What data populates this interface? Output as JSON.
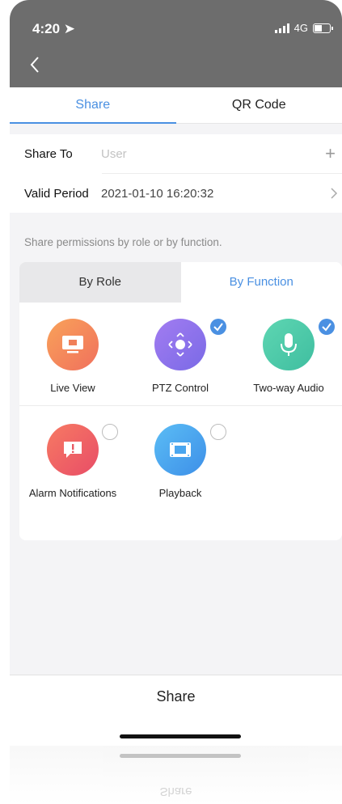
{
  "status": {
    "time": "4:20",
    "network": "4G"
  },
  "tabs": [
    {
      "label": "Share"
    },
    {
      "label": "QR Code"
    }
  ],
  "form": {
    "share_to": {
      "label": "Share To",
      "placeholder": "User"
    },
    "valid_period": {
      "label": "Valid Period",
      "value": "2021-01-10 16:20:32"
    }
  },
  "hint": "Share permissions by role or by function.",
  "segment": {
    "by_role": "By Role",
    "by_function": "By Function",
    "selected": "By Function"
  },
  "functions": [
    {
      "label": "Live View",
      "icon": "monitor-icon",
      "color": "#f5875a",
      "checked": false
    },
    {
      "label": "PTZ Control",
      "icon": "ptz-joystick-icon",
      "color": "#8f73e8",
      "checked": true
    },
    {
      "label": "Two-way Audio",
      "icon": "microphone-icon",
      "color": "#4ecaa8",
      "checked": true
    },
    {
      "label": "Alarm Notifications",
      "icon": "alarm-message-icon",
      "color": "#ef5f63",
      "checked": false
    },
    {
      "label": "Playback",
      "icon": "film-icon",
      "color": "#4aa6ef",
      "checked": false
    }
  ],
  "bottom": {
    "share_label": "Share"
  },
  "colors": {
    "accent": "#4a90e2",
    "header": "#6d6d6d"
  }
}
